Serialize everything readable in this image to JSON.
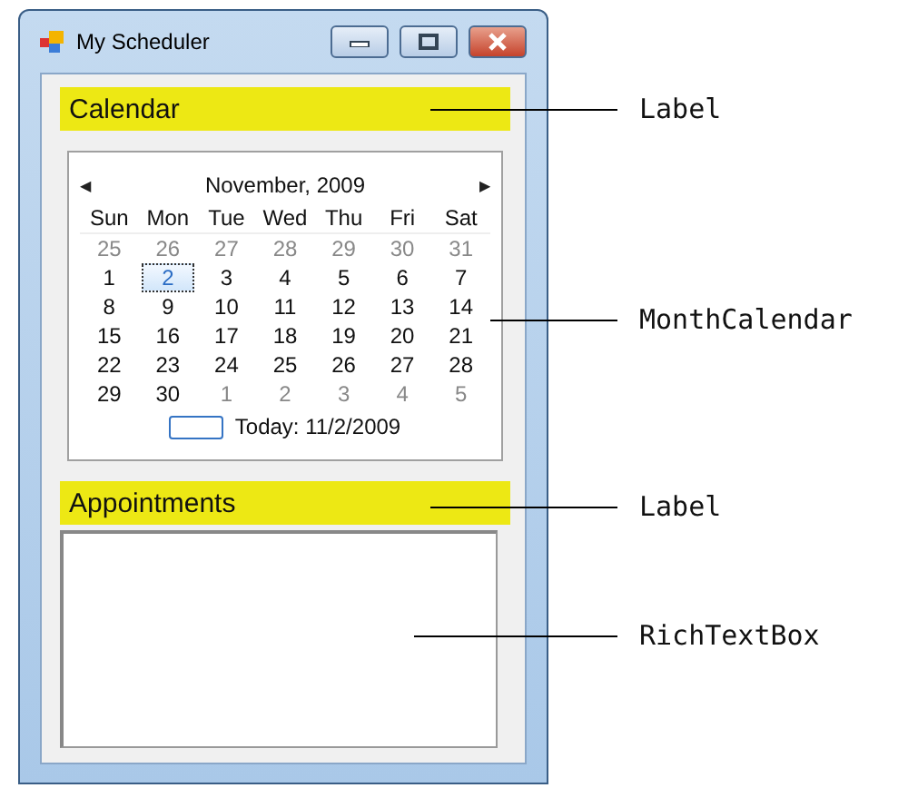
{
  "window": {
    "title": "My Scheduler"
  },
  "calendar_label": {
    "text": "Calendar"
  },
  "month_calendar": {
    "month": "November, 2009",
    "prev": "◀",
    "next": "▶",
    "weekdays": [
      "Sun",
      "Mon",
      "Tue",
      "Wed",
      "Thu",
      "Fri",
      "Sat"
    ],
    "weeks": [
      [
        {
          "day": "25",
          "other_month": true,
          "selected": false
        },
        {
          "day": "26",
          "other_month": true,
          "selected": false
        },
        {
          "day": "27",
          "other_month": true,
          "selected": false
        },
        {
          "day": "28",
          "other_month": true,
          "selected": false
        },
        {
          "day": "29",
          "other_month": true,
          "selected": false
        },
        {
          "day": "30",
          "other_month": true,
          "selected": false
        },
        {
          "day": "31",
          "other_month": true,
          "selected": false
        }
      ],
      [
        {
          "day": "1",
          "other_month": false,
          "selected": false
        },
        {
          "day": "2",
          "other_month": false,
          "selected": true
        },
        {
          "day": "3",
          "other_month": false,
          "selected": false
        },
        {
          "day": "4",
          "other_month": false,
          "selected": false
        },
        {
          "day": "5",
          "other_month": false,
          "selected": false
        },
        {
          "day": "6",
          "other_month": false,
          "selected": false
        },
        {
          "day": "7",
          "other_month": false,
          "selected": false
        }
      ],
      [
        {
          "day": "8",
          "other_month": false,
          "selected": false
        },
        {
          "day": "9",
          "other_month": false,
          "selected": false
        },
        {
          "day": "10",
          "other_month": false,
          "selected": false
        },
        {
          "day": "11",
          "other_month": false,
          "selected": false
        },
        {
          "day": "12",
          "other_month": false,
          "selected": false
        },
        {
          "day": "13",
          "other_month": false,
          "selected": false
        },
        {
          "day": "14",
          "other_month": false,
          "selected": false
        }
      ],
      [
        {
          "day": "15",
          "other_month": false,
          "selected": false
        },
        {
          "day": "16",
          "other_month": false,
          "selected": false
        },
        {
          "day": "17",
          "other_month": false,
          "selected": false
        },
        {
          "day": "18",
          "other_month": false,
          "selected": false
        },
        {
          "day": "19",
          "other_month": false,
          "selected": false
        },
        {
          "day": "20",
          "other_month": false,
          "selected": false
        },
        {
          "day": "21",
          "other_month": false,
          "selected": false
        }
      ],
      [
        {
          "day": "22",
          "other_month": false,
          "selected": false
        },
        {
          "day": "23",
          "other_month": false,
          "selected": false
        },
        {
          "day": "24",
          "other_month": false,
          "selected": false
        },
        {
          "day": "25",
          "other_month": false,
          "selected": false
        },
        {
          "day": "26",
          "other_month": false,
          "selected": false
        },
        {
          "day": "27",
          "other_month": false,
          "selected": false
        },
        {
          "day": "28",
          "other_month": false,
          "selected": false
        }
      ],
      [
        {
          "day": "29",
          "other_month": false,
          "selected": false
        },
        {
          "day": "30",
          "other_month": false,
          "selected": false
        },
        {
          "day": "1",
          "other_month": true,
          "selected": false
        },
        {
          "day": "2",
          "other_month": true,
          "selected": false
        },
        {
          "day": "3",
          "other_month": true,
          "selected": false
        },
        {
          "day": "4",
          "other_month": true,
          "selected": false
        },
        {
          "day": "5",
          "other_month": true,
          "selected": false
        }
      ]
    ],
    "today": "Today: 11/2/2009"
  },
  "appointments_label": {
    "text": "Appointments"
  },
  "annotations": [
    {
      "text": "Label"
    },
    {
      "text": "MonthCalendar"
    },
    {
      "text": "Label"
    },
    {
      "text": "RichTextBox"
    }
  ]
}
